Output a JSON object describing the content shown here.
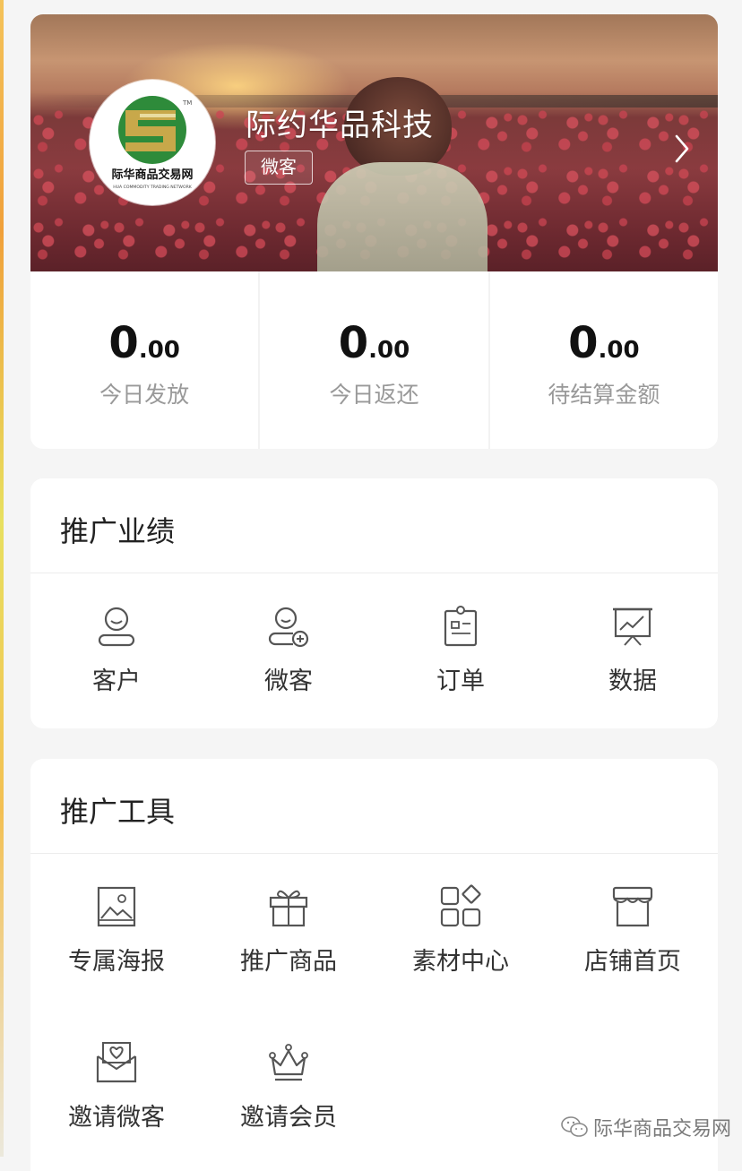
{
  "profile": {
    "shop_name": "际约华品科技",
    "role_tag": "微客",
    "logo_text": "际华商品交易网",
    "logo_subtext": "HUA COMMODITY TRADING NETWORK",
    "logo_tm": "TM"
  },
  "stats": [
    {
      "int": "0",
      "dec": ".00",
      "label": "今日发放"
    },
    {
      "int": "0",
      "dec": ".00",
      "label": "今日返还"
    },
    {
      "int": "0",
      "dec": ".00",
      "label": "待结算金额"
    }
  ],
  "performance": {
    "title": "推广业绩",
    "items": [
      {
        "label": "客户",
        "icon": "customer-icon"
      },
      {
        "label": "微客",
        "icon": "add-user-icon"
      },
      {
        "label": "订单",
        "icon": "clipboard-icon"
      },
      {
        "label": "数据",
        "icon": "chart-board-icon"
      }
    ]
  },
  "tools": {
    "title": "推广工具",
    "items": [
      {
        "label": "专属海报",
        "icon": "poster-image-icon"
      },
      {
        "label": "推广商品",
        "icon": "gift-icon"
      },
      {
        "label": "素材中心",
        "icon": "grid-apps-icon"
      },
      {
        "label": "店铺首页",
        "icon": "storefront-icon"
      },
      {
        "label": "邀请微客",
        "icon": "heart-envelope-icon"
      },
      {
        "label": "邀请会员",
        "icon": "crown-icon"
      }
    ]
  },
  "watermark": "际华商品交易网",
  "colors": {
    "logo_green": "#2e8b3a",
    "logo_gold": "#c8a84a"
  }
}
